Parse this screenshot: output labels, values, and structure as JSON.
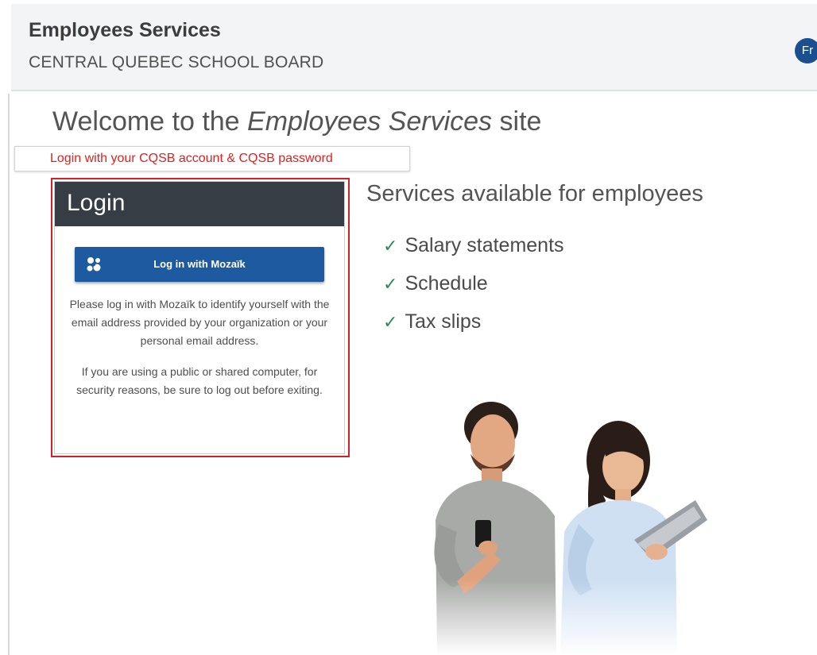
{
  "header": {
    "title": "Employees Services",
    "organization": "CENTRAL QUEBEC SCHOOL BOARD",
    "language_button": "Fr"
  },
  "welcome": {
    "prefix": "Welcome to the ",
    "emphasis": "Employees Services",
    "suffix": " site"
  },
  "notice": "Login with your CQSB account & CQSB password",
  "login": {
    "title": "Login",
    "button_label": "Log in with Mozaïk",
    "button_icon": "mozaik-logo-icon",
    "message1": "Please log in with Mozaïk to identify yourself with the email address provided by your organization or your personal email address.",
    "message2": "If you are using a public or shared computer, for security reasons, be sure to log out before exiting."
  },
  "services": {
    "title": "Services available for employees",
    "items": [
      "Salary statements",
      "Schedule",
      "Tax slips"
    ],
    "check_icon": "check-icon"
  },
  "colors": {
    "header_bg": "#f3f4f5",
    "login_header_bg": "#363d45",
    "primary_button": "#1e5aa0",
    "language_button": "#1b4f8f",
    "notice_text": "#e02020",
    "highlight_border": "#d0202a",
    "check": "#2e8b57"
  }
}
